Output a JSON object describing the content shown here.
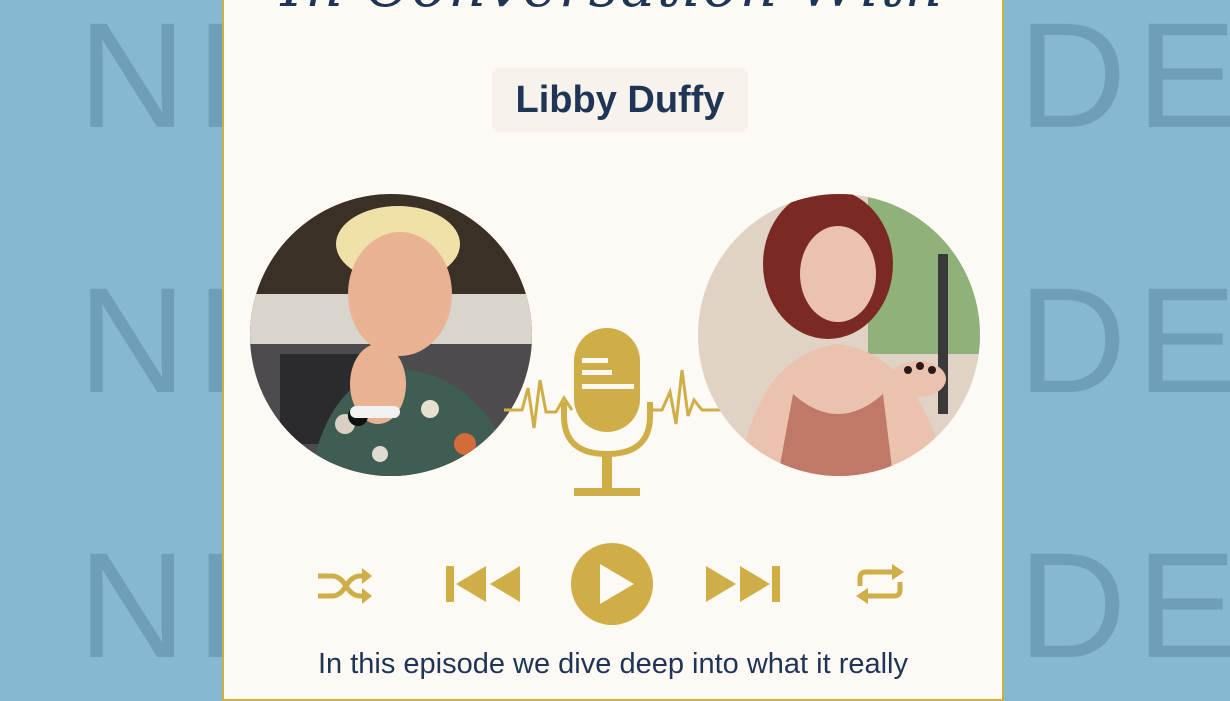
{
  "background": {
    "repeated_word": "NEW EPISODE",
    "color": "#86b8d0",
    "accent": "#cfae48",
    "text_color": "#1e3556"
  },
  "card": {
    "script_title": "In Conversation With",
    "guest_name": "Libby Duffy",
    "description": "In this episode we dive deep into what it really"
  },
  "icons": {
    "microphone": "microphone-icon",
    "shuffle": "shuffle-icon",
    "previous": "skip-previous-icon",
    "play": "play-icon",
    "next": "skip-next-icon",
    "repeat": "repeat-icon"
  }
}
